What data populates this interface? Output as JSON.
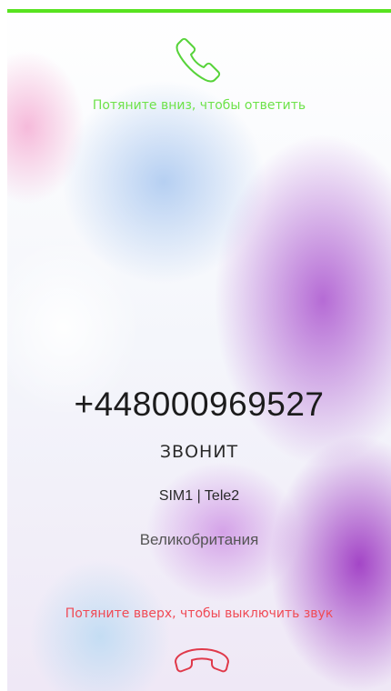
{
  "colors": {
    "accent_green": "#57e31f",
    "answer_green": "#6ee24a",
    "decline_red": "#f04a55"
  },
  "answer": {
    "icon": "phone-answer-icon",
    "hint": "Потяните вниз, чтобы ответить"
  },
  "call": {
    "number": "+448000969527",
    "status": "ЗВОНИТ",
    "sim": "SIM1 | Tele2",
    "location": "Великобритания"
  },
  "decline": {
    "hint": "Потяните вверх, чтобы выключить звук",
    "icon": "phone-hangup-icon"
  }
}
